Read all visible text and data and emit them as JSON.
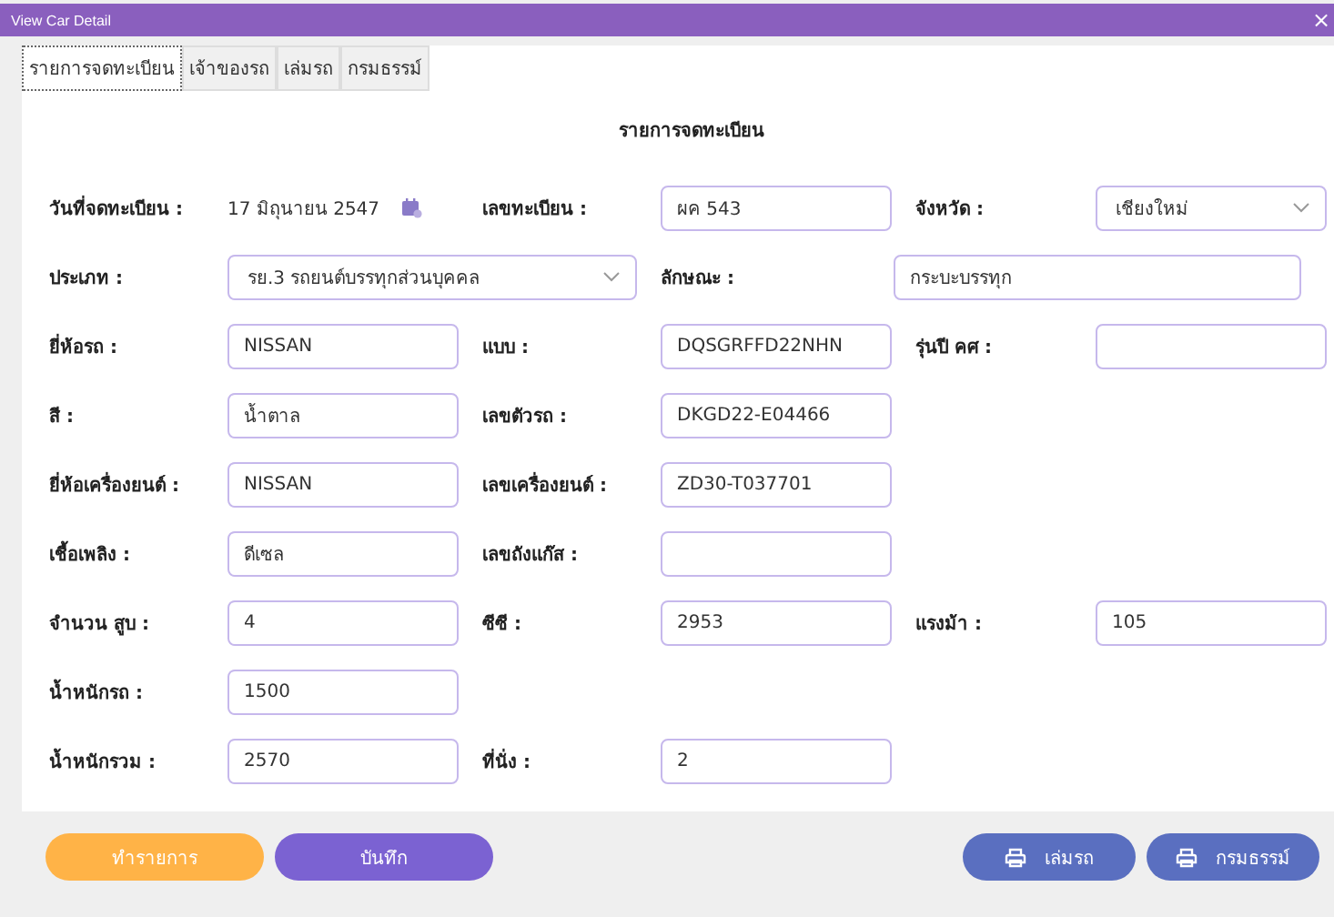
{
  "window": {
    "title": "View Car Detail",
    "close": "×"
  },
  "tabs": [
    {
      "label": "รายการจดทะเบียน",
      "selected": true
    },
    {
      "label": "เจ้าของรถ",
      "selected": false
    },
    {
      "label": "เล่มรถ",
      "selected": false
    },
    {
      "label": "กรมธรรม์",
      "selected": false
    }
  ],
  "section_title": "รายการจดทะเบียน",
  "rows": [
    {
      "kind": "grid",
      "items": [
        {
          "kind": "label",
          "text": "วันที่จดทะเบียน :"
        },
        {
          "kind": "date",
          "text": "17 มิถุนายน 2547"
        },
        {
          "kind": "label",
          "text": "เลขทะเบียน :"
        },
        {
          "kind": "input",
          "text": "ผค 543"
        },
        {
          "kind": "label",
          "text": "จังหวัด :"
        },
        {
          "kind": "select",
          "text": "เชียงใหม่"
        }
      ]
    },
    {
      "kind": "wide",
      "items": [
        {
          "kind": "label",
          "text": "ประเภท :"
        },
        {
          "kind": "select",
          "text": "รย.3 รถยนต์บรรทุกส่วนบุคคล"
        },
        {
          "kind": "label",
          "text": "ลักษณะ :"
        },
        {
          "kind": "input",
          "text": "กระบะบรรทุก"
        }
      ]
    },
    {
      "kind": "grid",
      "items": [
        {
          "kind": "label",
          "text": "ยี่ห้อรถ :"
        },
        {
          "kind": "input",
          "text": "NISSAN"
        },
        {
          "kind": "label",
          "text": "แบบ :"
        },
        {
          "kind": "input",
          "text": "DQSGRFFD22NHN"
        },
        {
          "kind": "label",
          "text": "รุ่นปี คศ :"
        },
        {
          "kind": "input"
        }
      ]
    },
    {
      "kind": "grid",
      "items": [
        {
          "kind": "label",
          "text": "สี :"
        },
        {
          "kind": "input",
          "text": "น้ำตาล"
        },
        {
          "kind": "label",
          "text": "เลขตัวรถ :"
        },
        {
          "kind": "input",
          "text": "DKGD22-E04466"
        }
      ]
    },
    {
      "kind": "grid",
      "items": [
        {
          "kind": "label",
          "text": "ยี่ห้อเครื่องยนต์ :"
        },
        {
          "kind": "input",
          "text": "NISSAN"
        },
        {
          "kind": "label",
          "text": "เลขเครื่องยนต์ :"
        },
        {
          "kind": "input",
          "text": "ZD30-T037701"
        }
      ]
    },
    {
      "kind": "grid",
      "items": [
        {
          "kind": "label",
          "text": "เชื้อเพลิง :"
        },
        {
          "kind": "input",
          "text": "ดีเซล"
        },
        {
          "kind": "label",
          "text": "เลขถังแก๊ส :"
        },
        {
          "kind": "input"
        }
      ]
    },
    {
      "kind": "grid",
      "items": [
        {
          "kind": "label",
          "text": "จำนวน สูบ :"
        },
        {
          "kind": "input",
          "text": "4"
        },
        {
          "kind": "label",
          "text": "ซีซี :"
        },
        {
          "kind": "input",
          "text": "2953"
        },
        {
          "kind": "label",
          "text": "แรงม้า :"
        },
        {
          "kind": "input",
          "text": "105"
        }
      ]
    },
    {
      "kind": "grid",
      "items": [
        {
          "kind": "label",
          "text": "น้ำหนักรถ :"
        },
        {
          "kind": "input",
          "text": "1500"
        }
      ]
    },
    {
      "kind": "grid",
      "items": [
        {
          "kind": "label",
          "text": "น้ำหนักรวม :"
        },
        {
          "kind": "input",
          "text": "2570"
        },
        {
          "kind": "label",
          "text": "ที่นั่ง :"
        },
        {
          "kind": "input",
          "text": "2"
        }
      ]
    }
  ],
  "actions": [
    {
      "label": "ทำรายการ",
      "kind": "process"
    },
    {
      "label": "บันทึก",
      "kind": "save"
    }
  ],
  "print_actions": [
    {
      "label": "เล่มรถ",
      "kind": "print"
    },
    {
      "label": "กรมธรรม์",
      "kind": "print"
    }
  ]
}
